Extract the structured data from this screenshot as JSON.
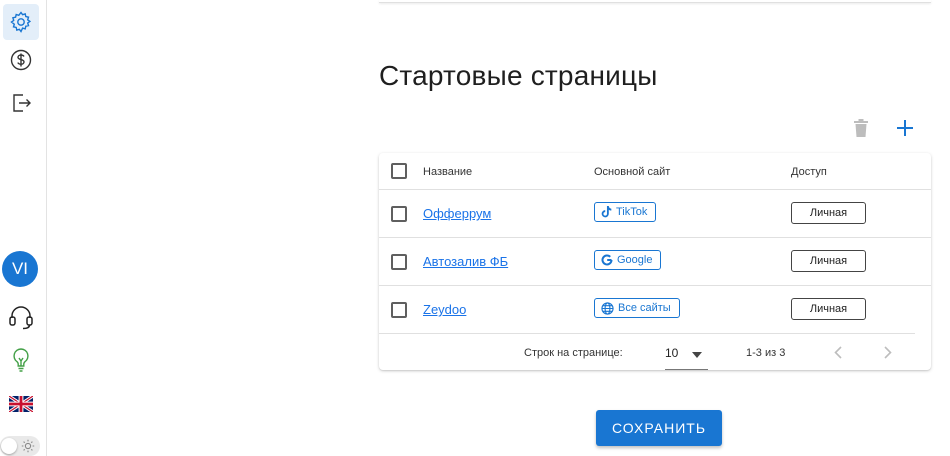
{
  "sidebar": {
    "avatar_initials": "VI",
    "icons": [
      "gear-icon",
      "dollar-icon",
      "logout-icon",
      "headset-icon",
      "lightbulb-icon",
      "uk-flag-icon",
      "sun-icon"
    ]
  },
  "page": {
    "title": "Стартовые страницы"
  },
  "table": {
    "headers": {
      "name": "Название",
      "site": "Основной сайт",
      "access": "Доступ"
    },
    "rows": [
      {
        "name": "Офферрум",
        "site": "TikTok",
        "site_icon": "tiktok-icon",
        "access": "Личная"
      },
      {
        "name": "Автозалив ФБ",
        "site": "Google",
        "site_icon": "google-icon",
        "access": "Личная"
      },
      {
        "name": "Zeydoo",
        "site": "Все сайты",
        "site_icon": "globe-icon",
        "access": "Личная"
      }
    ],
    "footer": {
      "rows_per_page_label": "Строк на странице:",
      "rows_per_page": "10",
      "range": "1-3 из 3"
    }
  },
  "actions": {
    "save": "СОХРАНИТЬ"
  },
  "colors": {
    "accent": "#1976d2",
    "link": "#1a73e8",
    "sidebar_active": "#e3eef9",
    "lightbulb": "#43a047"
  }
}
